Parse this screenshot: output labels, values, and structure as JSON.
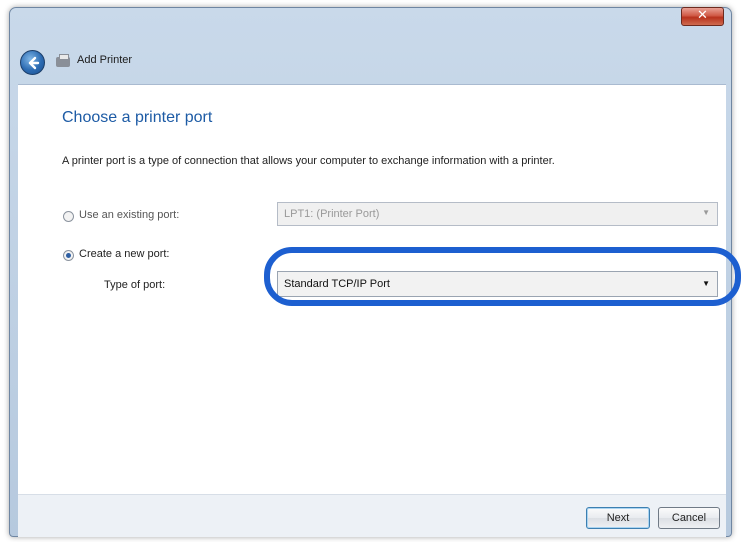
{
  "window": {
    "title": "Add Printer",
    "close_glyph": "✕"
  },
  "page": {
    "heading": "Choose a printer port",
    "description": "A printer port is a type of connection that allows your computer to exchange information with a printer."
  },
  "options": {
    "existing": {
      "label": "Use an existing port:",
      "selected": false,
      "dropdown_value": "LPT1: (Printer Port)"
    },
    "create_new": {
      "label": "Create a new port:",
      "selected": true,
      "type_label": "Type of port:",
      "dropdown_value": "Standard TCP/IP Port"
    }
  },
  "buttons": {
    "next": "Next",
    "cancel": "Cancel"
  },
  "colors": {
    "heading": "#1d5ba5",
    "highlight": "#1d5fd0"
  },
  "icons": {
    "back": "back-arrow-icon",
    "app": "printer-icon",
    "close": "close-icon",
    "dropdown": "chevron-down-icon"
  }
}
